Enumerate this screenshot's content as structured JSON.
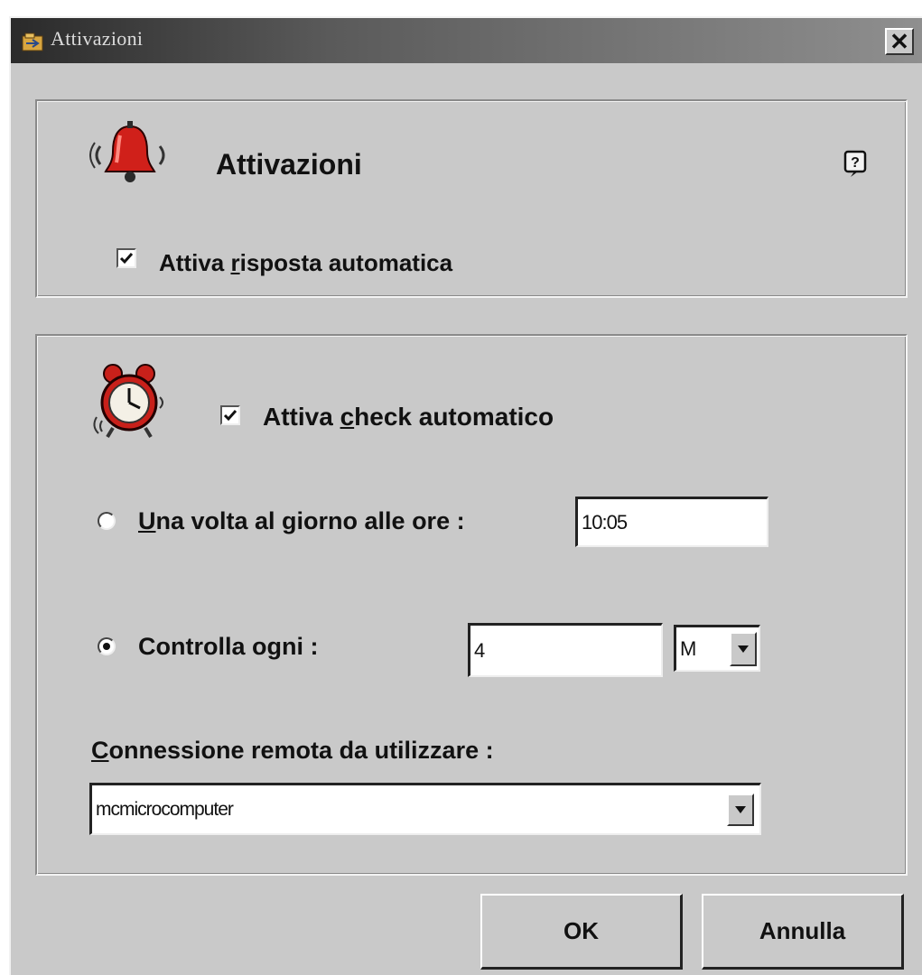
{
  "window": {
    "title": "Attivazioni"
  },
  "header": {
    "title": "Attivazioni"
  },
  "auto_reply": {
    "label_pre": "Attiva ",
    "label_key": "r",
    "label_post": "isposta automatica",
    "checked": true
  },
  "auto_check": {
    "label_pre": "Attiva ",
    "label_key": "c",
    "label_post": "heck automatico",
    "checked": true
  },
  "once_daily": {
    "label_key": "U",
    "label_post": "na volta al giorno alle ore :",
    "selected": false,
    "time_value": "10:05"
  },
  "check_every": {
    "label": "Controlla ogni :",
    "selected": true,
    "value": "4",
    "unit": "M"
  },
  "connection": {
    "label_key": "C",
    "label_post": "onnessione remota da utilizzare :",
    "value": "mcmicrocomputer"
  },
  "buttons": {
    "ok": "OK",
    "cancel": "Annulla"
  },
  "icons": {
    "bell": "bell-icon",
    "clock": "alarm-clock-icon",
    "help": "help-icon",
    "app": "app-icon"
  }
}
